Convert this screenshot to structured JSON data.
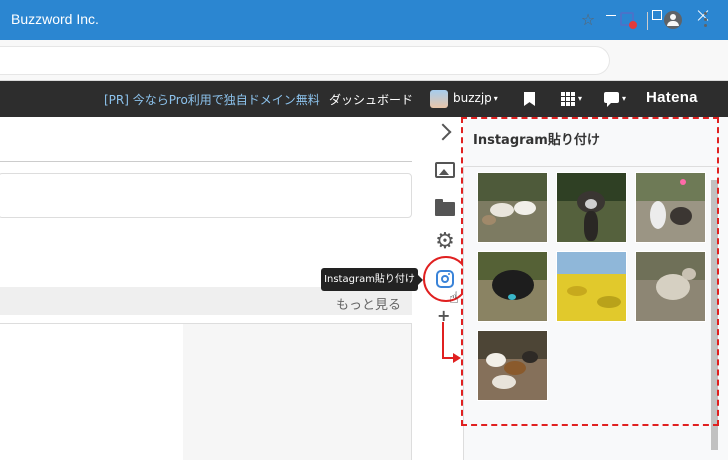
{
  "window": {
    "title": "Buzzword Inc."
  },
  "hatena_bar": {
    "promo": "[PR] 今ならPro利用で独自ドメイン無料",
    "dashboard": "ダッシュボード",
    "username": "buzzjp",
    "logo": "Hatena"
  },
  "editor": {
    "more_label": "もっと見る"
  },
  "tooltip": {
    "text": "Instagram貼り付け"
  },
  "panel": {
    "title": "Instagram貼り付け",
    "thumbnails": [
      {
        "subject": "goats"
      },
      {
        "subject": "emu"
      },
      {
        "subject": "goats-barn"
      },
      {
        "subject": "black-goat"
      },
      {
        "subject": "rapeseed-field"
      },
      {
        "subject": "sheep"
      },
      {
        "subject": "guinea-pigs"
      }
    ]
  },
  "colors": {
    "titlebar": "#2b86d1",
    "hatena_bar": "#2d2d2d",
    "promo_text": "#8cc2ec",
    "highlight_red": "#e02020",
    "instagram_icon": "#3a83d8"
  }
}
